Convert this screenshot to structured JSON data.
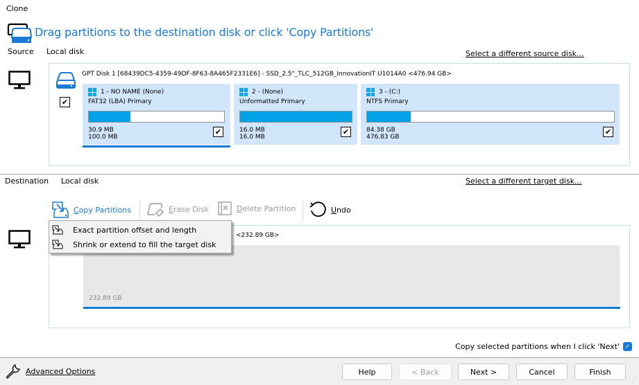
{
  "window": {
    "title": "Clone"
  },
  "header": {
    "title": "Drag partitions to the destination disk or click 'Copy Partitions'"
  },
  "source": {
    "label": "Source",
    "type": "Local disk",
    "change_link": "Select a different source disk...",
    "disk": {
      "label": "GPT Disk 1 [68439DC5-4359-49DF-8F63-8A465F2331E6] - SSD_2.5\"_TLC_512GB_InnovationIT U1014A0  <476.94 GB>",
      "checked": true
    },
    "partitions": [
      {
        "name": "1 - NO NAME (None)",
        "type": "FAT32 (LBA) Primary",
        "used": "30.9 MB",
        "total": "100.0 MB",
        "used_fraction": 0.309,
        "checked": true,
        "selected": true
      },
      {
        "name": "2 -  (None)",
        "type": "Unformatted Primary",
        "used": "16.0 MB",
        "total": "16.0 MB",
        "used_fraction": 1.0,
        "checked": true,
        "selected": false
      },
      {
        "name": "3 -  (C:)",
        "type": "NTFS Primary",
        "used": "84.38 GB",
        "total": "476.83 GB",
        "used_fraction": 0.177,
        "checked": true,
        "selected": false
      }
    ]
  },
  "destination": {
    "label": "Destination",
    "type": "Local disk",
    "change_link": "Select a different target disk...",
    "disk_size_label": "<232.89 GB>",
    "unallocated_size": "232.89 GB"
  },
  "toolbar": {
    "copy_partitions": {
      "accel": "C",
      "rest": "opy Partitions"
    },
    "erase_disk": {
      "accel": "E",
      "rest": "rase Disk"
    },
    "delete_partition": {
      "accel": "D",
      "rest": "elete Partition"
    },
    "undo": {
      "accel": "U",
      "rest": "ndo"
    }
  },
  "copy_menu": {
    "items": [
      {
        "label": "Exact partition offset and length"
      },
      {
        "label": "Shrink or extend to fill the target disk"
      }
    ]
  },
  "confirm": {
    "label": "Copy selected partitions when I click 'Next'",
    "checked": true,
    "check_glyph": "✓"
  },
  "footer": {
    "advanced_options": "Advanced Options",
    "help": "Help",
    "back": "< Back",
    "next": "Next >",
    "cancel": "Cancel",
    "finish": "Finish"
  },
  "glyphs": {
    "check": "✔"
  },
  "colors": {
    "accent": "#1a7ad6",
    "partition_bg": "#d2e6fb",
    "usage_fill": "#03a1e6",
    "selection_line": "#0a7ad0"
  }
}
